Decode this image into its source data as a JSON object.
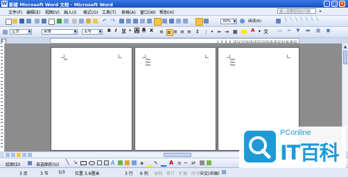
{
  "window": {
    "title": "新建 Microsoft Word 文档 - Microsoft Word",
    "icon": "word-icon"
  },
  "menu": {
    "items": [
      "文件(F)",
      "编辑(E)",
      "视图(V)",
      "插入(I)",
      "格式(O)",
      "工具(T)",
      "表格(A)",
      "窗口(W)",
      "帮助(H)"
    ],
    "help_placeholder": "键入需要帮助的问题"
  },
  "standard_toolbar": {
    "zoom": "30%",
    "read_button": "阅读(R)"
  },
  "format_toolbar": {
    "style": "正文",
    "font": "宋体",
    "size": "五号",
    "bold": "B",
    "italic": "I",
    "underline": "U",
    "char_border": "A",
    "char_shading": "A",
    "char_scale": "X",
    "font_color_glyph": "A"
  },
  "ruler": {
    "ticks": [
      "2",
      "4",
      "6",
      "8",
      "10",
      "12",
      "14",
      "16",
      "18",
      "20",
      "22",
      "24",
      "26",
      "28",
      "30",
      "32",
      "34",
      "36",
      "38",
      "42"
    ]
  },
  "pages": [
    {
      "lines": [
        "Ma"
      ]
    },
    {
      "lines": [
        "Mao",
        "Mao",
        "Mao"
      ]
    },
    {
      "lines": [
        "Mao",
        "Mao",
        "Mao"
      ]
    }
  ],
  "drawing_toolbar": {
    "draw_menu": "绘图(D)",
    "autoshapes_menu": "自选图形(U)"
  },
  "statusbar": {
    "page": "3 页",
    "section": "3 节",
    "page_of": "3/3",
    "position": "位置 3.6厘米",
    "line": "3 行",
    "column": "6 列",
    "rec": "录制",
    "trk": "修订",
    "ext": "扩展",
    "ovr": "改写",
    "language": "中文(中国)"
  },
  "watermark": {
    "site": "PConline",
    "brand": "IT百科"
  }
}
